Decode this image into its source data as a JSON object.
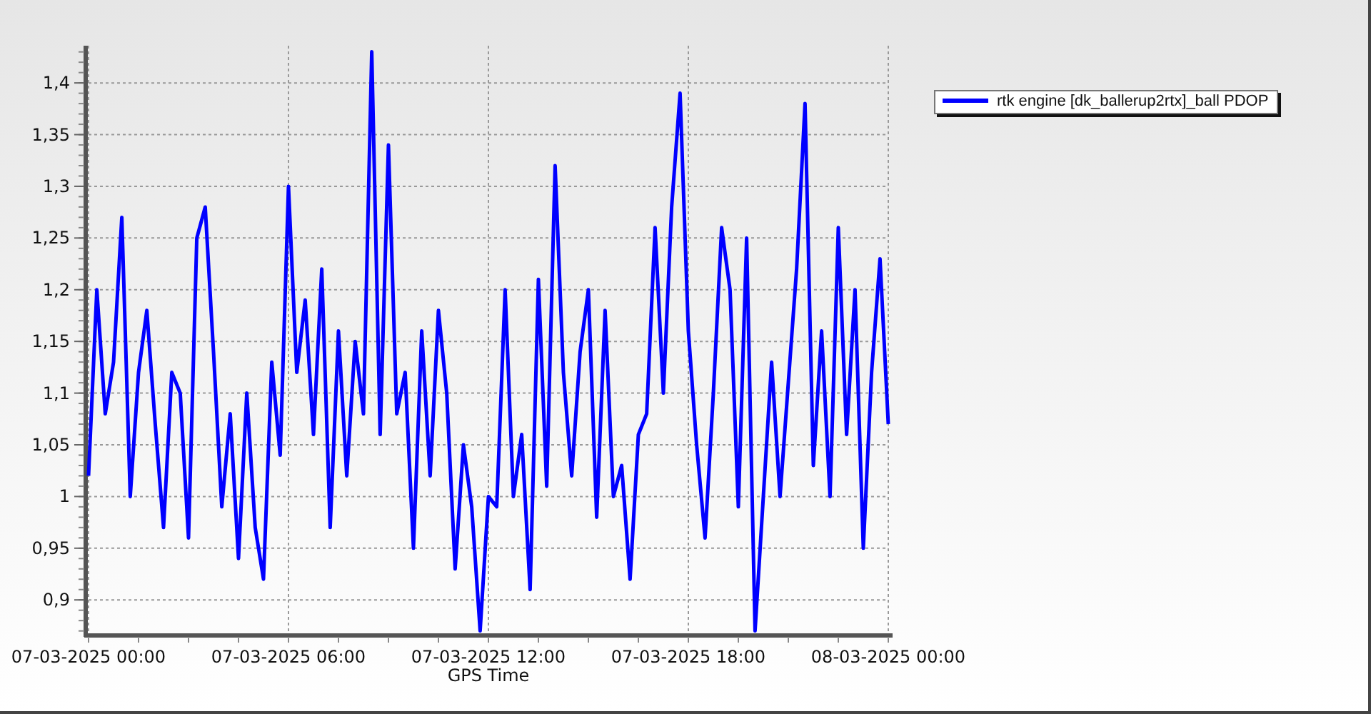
{
  "chart": {
    "chart_data": {
      "type": "line",
      "xlabel": "GPS Time",
      "grid": true,
      "categories": [
        "07-03-2025 00:00",
        null,
        null,
        null,
        null,
        null,
        null,
        null,
        null,
        null,
        null,
        null,
        null,
        null,
        null,
        null,
        null,
        null,
        null,
        null,
        null,
        null,
        null,
        null,
        "07-03-2025 06:00",
        null,
        null,
        null,
        null,
        null,
        null,
        null,
        null,
        null,
        null,
        null,
        null,
        null,
        null,
        null,
        null,
        null,
        null,
        null,
        null,
        null,
        null,
        null,
        "07-03-2025 12:00",
        null,
        null,
        null,
        null,
        null,
        null,
        null,
        null,
        null,
        null,
        null,
        null,
        null,
        null,
        null,
        null,
        null,
        null,
        null,
        null,
        null,
        null,
        null,
        "07-03-2025 18:00",
        null,
        null,
        null,
        null,
        null,
        null,
        null,
        null,
        null,
        null,
        null,
        null,
        null,
        null,
        null,
        null,
        null,
        null,
        null,
        null,
        null,
        null,
        null,
        "08-03-2025 00:00"
      ],
      "series": [
        {
          "name": "rtk engine [dk_ballerup2rtx]_ball PDOP",
          "color": "#0000ff",
          "values": [
            1.02,
            1.2,
            1.08,
            1.13,
            1.27,
            1.0,
            1.12,
            1.18,
            1.07,
            0.97,
            1.12,
            1.1,
            0.96,
            1.25,
            1.28,
            1.14,
            0.99,
            1.08,
            0.94,
            1.1,
            0.97,
            0.92,
            1.13,
            1.04,
            1.3,
            1.12,
            1.19,
            1.06,
            1.22,
            0.97,
            1.16,
            1.02,
            1.15,
            1.08,
            1.43,
            1.06,
            1.34,
            1.08,
            1.12,
            0.95,
            1.16,
            1.02,
            1.18,
            1.1,
            0.93,
            1.05,
            0.99,
            0.87,
            1.0,
            0.99,
            1.2,
            1.0,
            1.06,
            0.91,
            1.21,
            1.01,
            1.32,
            1.12,
            1.02,
            1.14,
            1.2,
            0.98,
            1.18,
            1.0,
            1.03,
            0.92,
            1.06,
            1.08,
            1.26,
            1.1,
            1.28,
            1.39,
            1.16,
            1.05,
            0.96,
            1.1,
            1.26,
            1.2,
            0.99,
            1.25,
            0.87,
            1.0,
            1.13,
            1.0,
            1.11,
            1.22,
            1.38,
            1.03,
            1.16,
            1.0,
            1.26,
            1.06,
            1.2,
            0.95,
            1.12,
            1.23,
            1.07
          ]
        }
      ],
      "ylim": [
        0.867,
        1.436
      ],
      "yticks": [
        {
          "value": 0.9,
          "label": "0,9"
        },
        {
          "value": 0.95,
          "label": "0,95"
        },
        {
          "value": 1,
          "label": "1"
        },
        {
          "value": 1.05,
          "label": "1,05"
        },
        {
          "value": 1.1,
          "label": "1,1"
        },
        {
          "value": 1.15,
          "label": "1,15"
        },
        {
          "value": 1.2,
          "label": "1,2"
        },
        {
          "value": 1.25,
          "label": "1,25"
        },
        {
          "value": 1.3,
          "label": "1,3"
        },
        {
          "value": 1.35,
          "label": "1,35"
        },
        {
          "value": 1.4,
          "label": "1,4"
        }
      ]
    }
  }
}
